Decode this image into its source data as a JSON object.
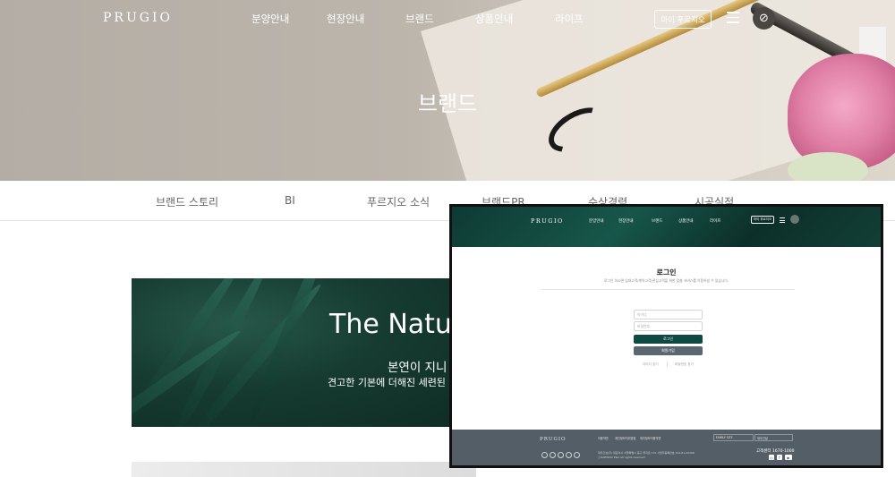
{
  "header": {
    "logo": "PRUGIO",
    "menu": [
      "분양안내",
      "현장안내",
      "브랜드",
      "상품안내",
      "라이프"
    ],
    "my_button": "마이 푸르지오",
    "icons": [
      "hamburger-menu-icon",
      "leaf-icon"
    ]
  },
  "hero": {
    "title": "브랜드"
  },
  "tabs": [
    "브랜드 스토리",
    "BI",
    "푸르지오 소식",
    "브랜드PR",
    "수상경력",
    "시공실적"
  ],
  "banner": {
    "title": "The Natura",
    "subtitle": "본연이 지니",
    "caption": "견고한 기본에 더해진 세련된 편안"
  },
  "popup": {
    "header": {
      "logo": "PRUGIO",
      "menu": [
        "분양안내",
        "현장안내",
        "브랜드",
        "상품안내",
        "라이프"
      ],
      "my_button": "마이 푸르지오"
    },
    "title": "로그인",
    "description": "로그인 하시면 임대고객/계약고객/관심고객을 위한 맞춤 서비스를 이용하실 수 있습니다.",
    "id_placeholder": "아이디",
    "pw_placeholder": "비밀번호",
    "login_button": "로그인",
    "join_button": "회원가입",
    "find_id": "아이디 찾기",
    "find_pw": "비밀번호 찾기",
    "footer": {
      "logo": "PRUGIO",
      "links": [
        "이용약관",
        "개인정보처리방침",
        "위치정보이용약관"
      ],
      "family_site": "FAMILY SITE",
      "lang": "대우건설",
      "address": "대우건설(주) 대표이사 서울특별시 중구 을지로 170 사업자등록번호 104-81-00308",
      "copyright": "ⓒDAEWOO E&C All rights reserved",
      "tel": "고객센터 1670-1000",
      "accent": "#0e4a42"
    }
  }
}
